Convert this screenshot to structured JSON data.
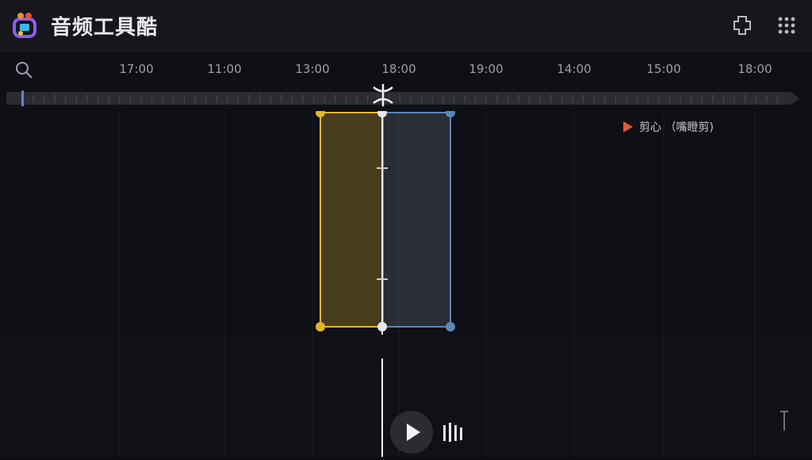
{
  "app": {
    "title": "音频工具酷"
  },
  "ruler": {
    "labels": [
      "17:00",
      "11:00",
      "13:00",
      "18:00",
      "19:00",
      "14:00",
      "15:00",
      "18:00"
    ]
  },
  "selection": {
    "legend_label": "剪心 （嘴瞪剪)"
  },
  "icons": {
    "logo": "app-logo-icon",
    "pin": "pin-icon",
    "grid": "grid-icon",
    "search": "search-icon",
    "play": "play-icon",
    "bars": "equalizer-icon",
    "marker": "marker-icon"
  },
  "colors": {
    "background": "#0f1015",
    "titlebar": "#15171c",
    "selection_yellow": "#e0b72c",
    "selection_blue": "#5d86b8",
    "legend_triangle": "#e0593c",
    "wave_start": "#3b6fd6",
    "wave_mid": "#2fae8b",
    "wave_end": "#f08a2d"
  }
}
